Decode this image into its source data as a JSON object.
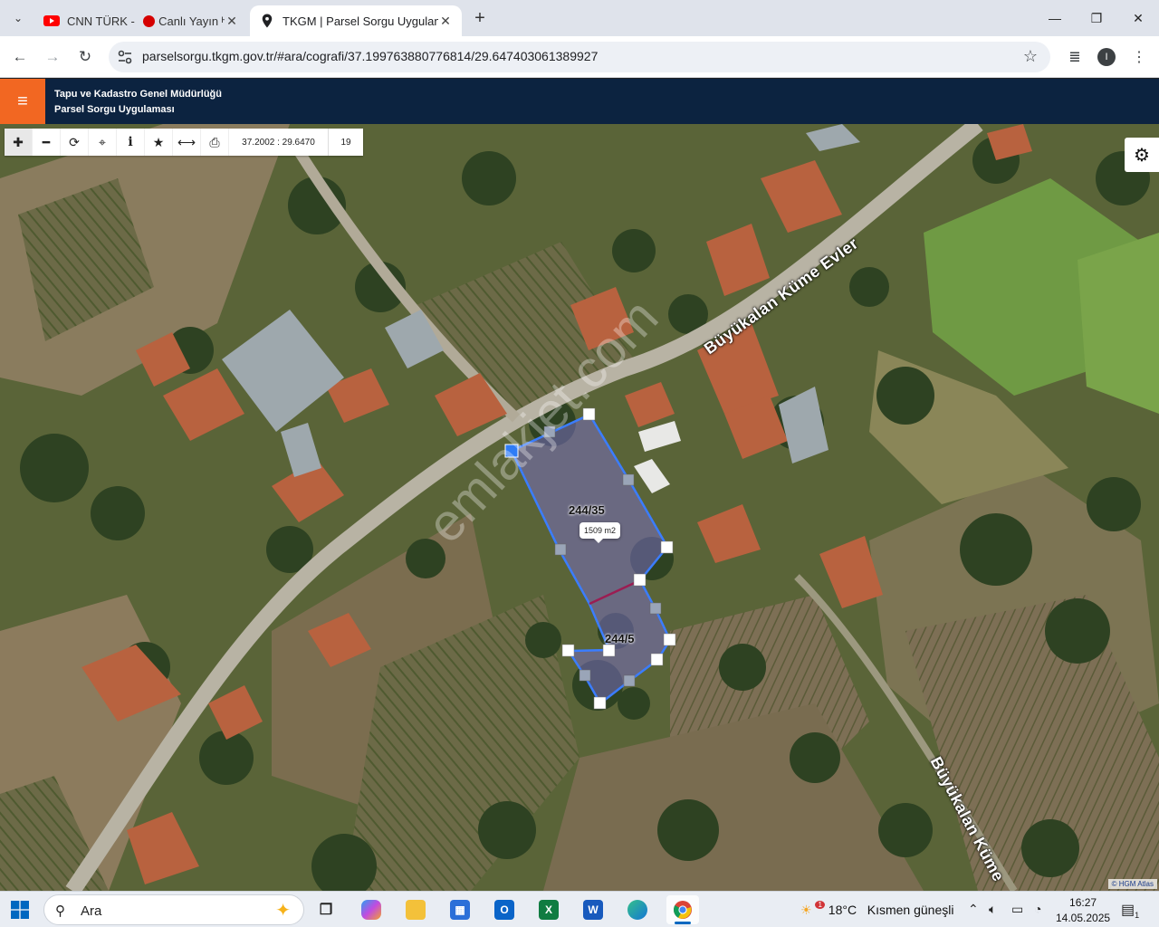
{
  "browser": {
    "tabs": [
      {
        "title": "CNN TÜRK - 🔴 Canlı Yayın ᴴᴰ",
        "title_text": "CNN TÜRK - ",
        "title_suffix": "Canlı Yayın ᴴᴰ",
        "icon": "youtube-icon",
        "active": false
      },
      {
        "title": "TKGM | Parsel Sorgu Uygulaması",
        "icon": "map-pin-icon",
        "active": true
      }
    ],
    "new_tab": "+",
    "address": "parselsorgu.tkgm.gov.tr/#ara/cografi/37.199763880776814/29.647403061389927",
    "profile_initial": "I"
  },
  "app": {
    "title_line1": "Tapu ve Kadastro Genel Müdürlüğü",
    "title_line2": "Parsel Sorgu Uygulaması",
    "accent_color": "#f26722",
    "header_color": "#0c2340"
  },
  "map": {
    "coordinates": "37.2002 : 29.6470",
    "zoom_level": "19",
    "tools": [
      "zoom-in-icon",
      "zoom-out-icon",
      "refresh-icon",
      "locate-icon",
      "info-icon",
      "bookmark-star-icon",
      "measure-icon",
      "print-icon"
    ],
    "street_names": [
      "Büyükalan Küme Evler",
      "Büyükalan Küme"
    ],
    "parcels": [
      {
        "label": "244/35"
      },
      {
        "label": "244/5"
      }
    ],
    "area_tooltip": "1509 m2",
    "watermark": "emlakjet.com",
    "attribution": "© HGM Atlas",
    "parcel_color": "#3b7dff"
  },
  "taskbar": {
    "search_placeholder": "Ara",
    "pinned_apps": [
      "task-view-icon",
      "copilot-icon",
      "file-explorer-icon",
      "store-icon",
      "outlook-icon",
      "excel-icon",
      "word-icon",
      "edge-icon",
      "chrome-icon"
    ],
    "weather_temp": "18°C",
    "weather_desc": "Kısmen güneşli",
    "weather_badge": "1",
    "time": "16:27",
    "date": "14.05.2025",
    "notification_count": "1"
  }
}
